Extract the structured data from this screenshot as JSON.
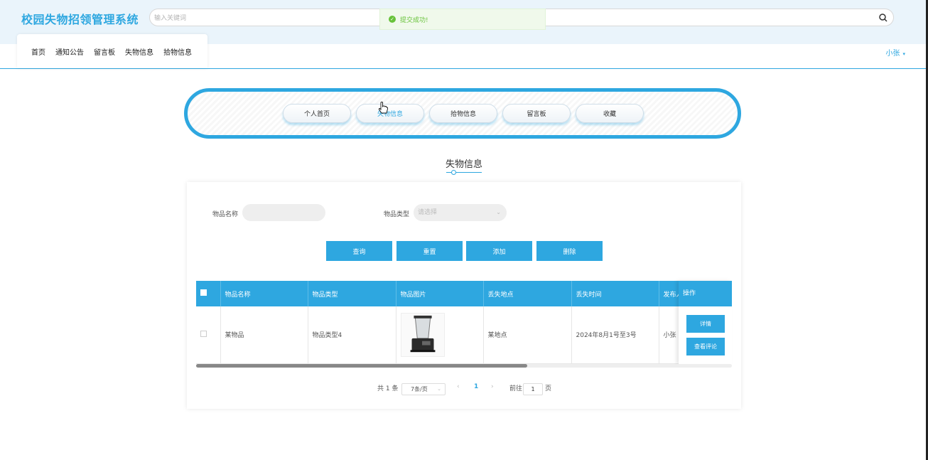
{
  "header": {
    "site_title": "校园失物招领管理系统",
    "search_placeholder": "输入关键词"
  },
  "toast": {
    "message": "提交成功!"
  },
  "nav": {
    "items": [
      "首页",
      "通知公告",
      "留言板",
      "失物信息",
      "拾物信息"
    ],
    "user": "小张"
  },
  "tabs": {
    "items": [
      "个人首页",
      "失物信息",
      "拾物信息",
      "留言板",
      "收藏"
    ],
    "active": 1
  },
  "section_title": "失物信息",
  "filters": {
    "name_label": "物品名称",
    "name_value": "",
    "type_label": "物品类型",
    "type_placeholder": "请选择"
  },
  "buttons": {
    "query": "查询",
    "reset": "重置",
    "add": "添加",
    "delete": "删除"
  },
  "table": {
    "columns": [
      "物品名称",
      "物品类型",
      "物品图片",
      "丢失地点",
      "丢失时间",
      "发布人"
    ],
    "operation_header": "操作",
    "rows": [
      {
        "name": "某物品",
        "type": "物品类型4",
        "image": "blender-image",
        "location": "某地点",
        "time": "2024年8月1号至3号",
        "publisher": "小张"
      }
    ],
    "row_actions": [
      "详情",
      "查看评论"
    ]
  },
  "pagination": {
    "total_text": "共 1 条",
    "page_size": "7条/页",
    "current_page": "1",
    "goto_label": "前往",
    "goto_value": "1",
    "page_unit": "页"
  },
  "colors": {
    "accent": "#2ea7e0",
    "header_bg": "#eaf4fb",
    "success": "#67c23a"
  }
}
